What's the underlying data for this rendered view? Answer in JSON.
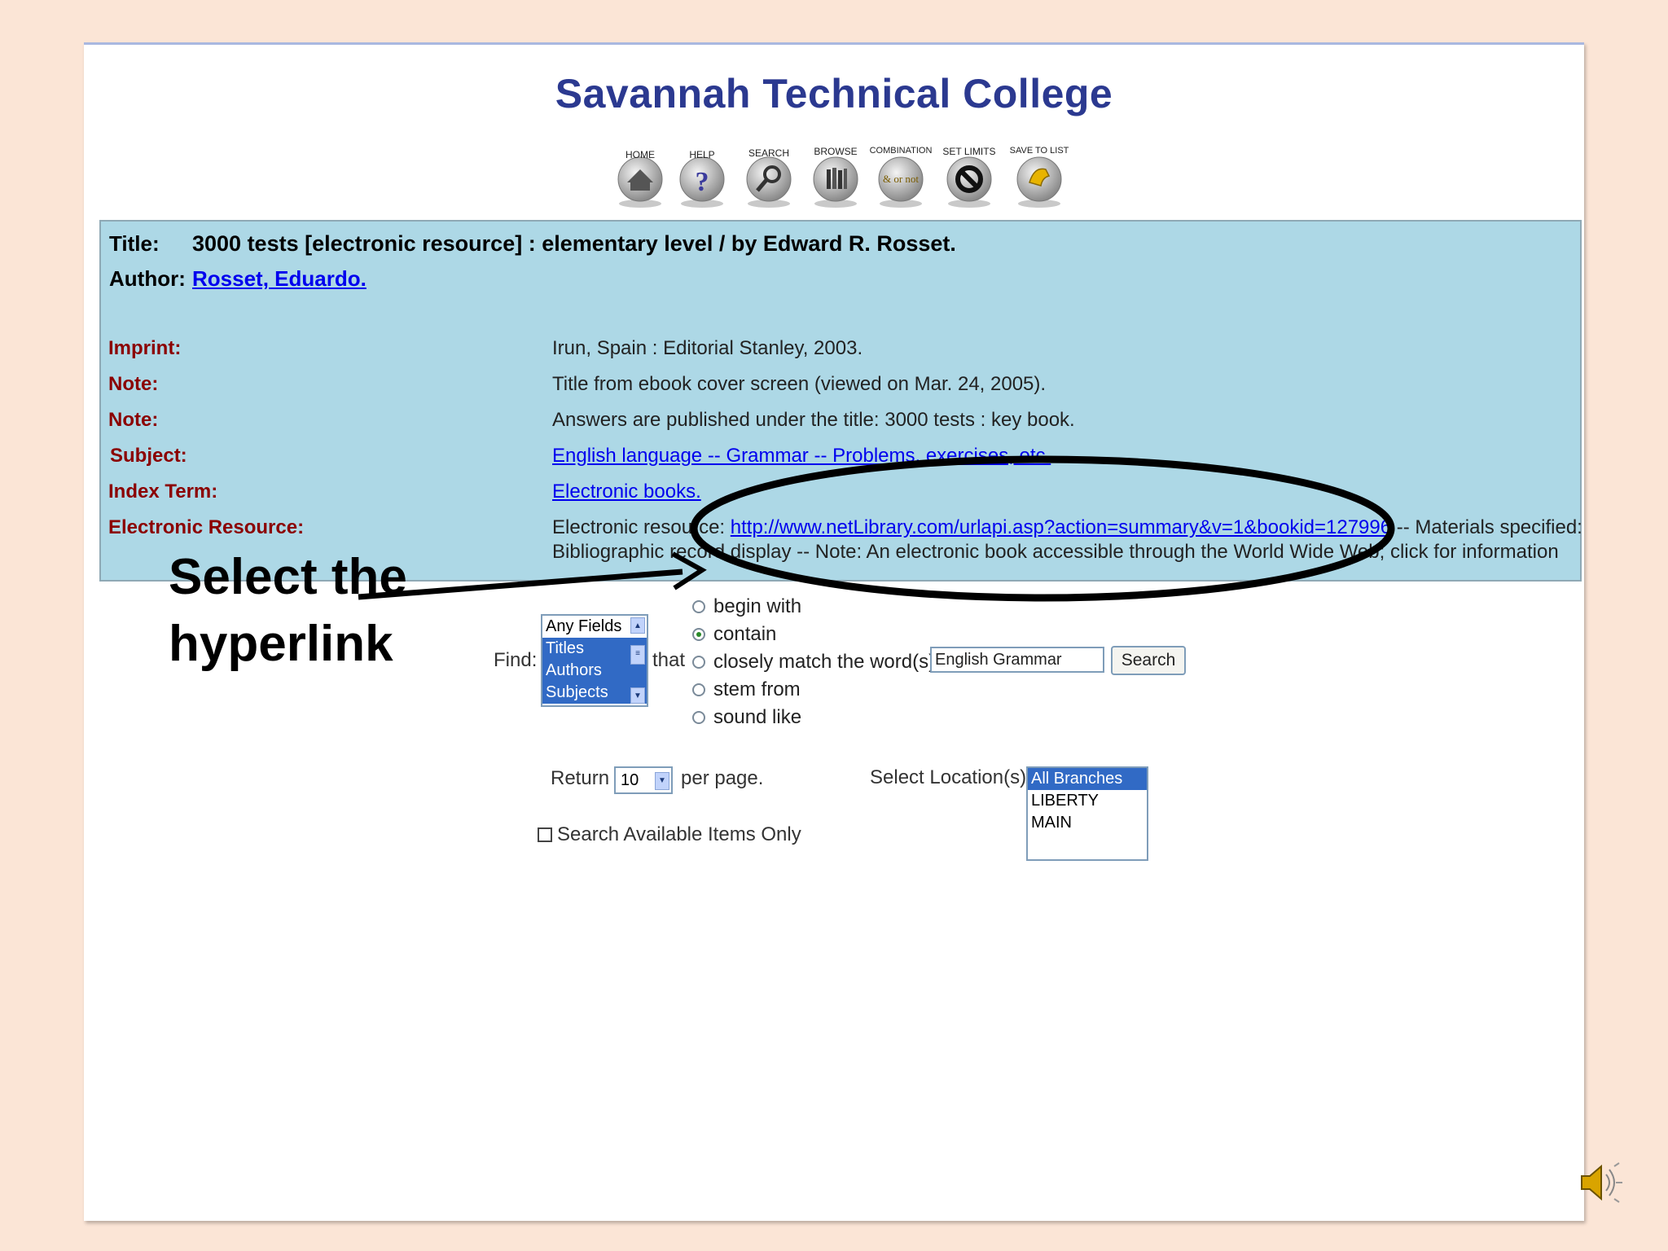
{
  "site": {
    "title": "Savannah Technical College"
  },
  "toolbar": {
    "home": "HOME",
    "help": "HELP",
    "search": "SEARCH",
    "browse": "BROWSE",
    "combination": "COMBINATION",
    "combination_inner": "& or not",
    "set_limits": "SET LIMITS",
    "save_to_list": "SAVE TO LIST"
  },
  "record": {
    "title_label": "Title:",
    "title_value": "3000 tests [electronic resource] : elementary level / by Edward R. Rosset.",
    "author_label": "Author:",
    "author_value": "Rosset, Eduardo.",
    "imprint_label": "Imprint:",
    "imprint_value": "Irun, Spain : Editorial Stanley, 2003.",
    "note1_label": "Note:",
    "note1_value": "Title from ebook cover screen (viewed on Mar. 24, 2005).",
    "note2_label": "Note:",
    "note2_value": "Answers are published under the title: 3000 tests : key book.",
    "subject_label": "Subject:",
    "subject_value": "English language -- Grammar -- Problems, exercises, etc.",
    "index_label": "Index Term:",
    "index_value": "Electronic books.",
    "eresource_label": "Electronic Resource:",
    "eresource_prefix": "Electronic resource:",
    "eresource_link": "http://www.netLibrary.com/urlapi.asp?action=summary&v=1&bookid=127996",
    "eresource_suffix": "-- Materials specified:",
    "eresource_line2": "Bibliographic record display -- Note: An electronic book accessible through the World Wide Web; click for information"
  },
  "annotation": {
    "line1": "Select the",
    "line2": "hyperlink"
  },
  "search_form": {
    "find_label": "Find:",
    "fields": [
      "Any Fields",
      "Titles",
      "Authors",
      "Subjects"
    ],
    "that_label": "that",
    "match_options": [
      "begin with",
      "contain",
      "closely match the word(s)",
      "stem from",
      "sound like"
    ],
    "selected_match": "contain",
    "query_value": "English Grammar",
    "search_button": "Search",
    "return_label": "Return",
    "per_page_value": "10",
    "per_page_label": "per page.",
    "location_label": "Select Location(s)",
    "locations": [
      "All Branches",
      "LIBERTY",
      "MAIN"
    ],
    "available_only_label": "Search Available Items Only"
  },
  "colors": {
    "title_blue": "#2b3990",
    "panel_blue": "#add8e6",
    "label_red": "#8b0000",
    "link_blue": "#0000ee",
    "background": "#fbe5d6"
  }
}
